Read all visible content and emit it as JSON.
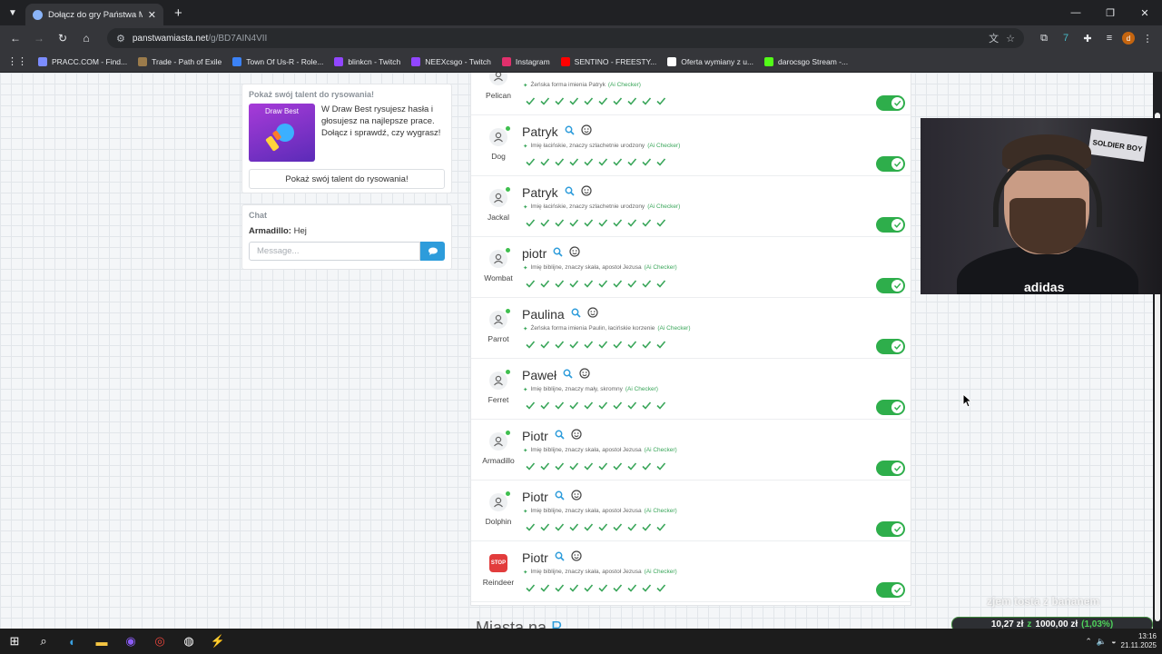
{
  "browser": {
    "tab_title": "Dołącz do gry Państwa Miasta",
    "url_host": "panstwamiasta.net",
    "url_path": "/g/BD7AIN4VII",
    "bookmarks": [
      {
        "label": "PRACC.COM - Find...",
        "color": "#7b8cff"
      },
      {
        "label": "Trade - Path of Exile",
        "color": "#9b7b4b"
      },
      {
        "label": "Town Of Us-R - Role...",
        "color": "#3b82f6"
      },
      {
        "label": "blinkcn - Twitch",
        "color": "#9146ff"
      },
      {
        "label": "NEEXcsgo - Twitch",
        "color": "#9146ff"
      },
      {
        "label": "Instagram",
        "color": "#e1306c"
      },
      {
        "label": "SENTINO - FREESTY...",
        "color": "#ff0000"
      },
      {
        "label": "Oferta wymiany z u...",
        "color": "#ffffff"
      },
      {
        "label": "darocsgo Stream -...",
        "color": "#53fc18"
      }
    ],
    "profile_initial": "d"
  },
  "promo": {
    "heading": "Pokaż swój talent do rysowania!",
    "thumb_title": "Draw Best",
    "description": "W Draw Best rysujesz hasła i głosujesz na najlepsze prace. Dołącz i sprawdź, czy wygrasz!",
    "button": "Pokaż swój talent do rysowania!"
  },
  "chat": {
    "heading": "Chat",
    "author": "Armadillo:",
    "message": "Hej",
    "placeholder": "Message..."
  },
  "answers": [
    {
      "player": "Pelican",
      "word": "",
      "hint": "Żeńska forma imienia Patryk",
      "ai": "(Ai Checker)",
      "stop": false
    },
    {
      "player": "Dog",
      "word": "Patryk",
      "hint": "Imię łacińskie, znaczy szlachetnie urodzony",
      "ai": "(Ai Checker)",
      "stop": false
    },
    {
      "player": "Jackal",
      "word": "Patryk",
      "hint": "Imię łacińskie, znaczy szlachetnie urodzony",
      "ai": "(Ai Checker)",
      "stop": false
    },
    {
      "player": "Wombat",
      "word": "piotr",
      "hint": "Imię biblijne, znaczy skała, apostoł Jezusa",
      "ai": "(Ai Checker)",
      "stop": false
    },
    {
      "player": "Parrot",
      "word": "Paulina",
      "hint": "Żeńska forma imienia Paulin, łacińskie korzenie",
      "ai": "(Ai Checker)",
      "stop": false
    },
    {
      "player": "Ferret",
      "word": "Paweł",
      "hint": "Imię biblijne, znaczy mały, skromny",
      "ai": "(Ai Checker)",
      "stop": false
    },
    {
      "player": "Armadillo",
      "word": "Piotr",
      "hint": "Imię biblijne, znaczy skała, apostoł Jezusa",
      "ai": "(Ai Checker)",
      "stop": false
    },
    {
      "player": "Dolphin",
      "word": "Piotr",
      "hint": "Imię biblijne, znaczy skała, apostoł Jezusa",
      "ai": "(Ai Checker)",
      "stop": false
    },
    {
      "player": "Reindeer",
      "word": "Piotr",
      "hint": "Imię biblijne, znaczy skała, apostoł Jezusa",
      "ai": "(Ai Checker)",
      "stop": true
    }
  ],
  "votes_per_row": 10,
  "next_section": {
    "text": "Miasta na",
    "letter": "P"
  },
  "stream": {
    "overlay_text": "zjem tosta z bananem",
    "donation_current": "10,27 zł",
    "donation_sep": "z",
    "donation_goal": "1000,00 zł",
    "donation_percent": "(1,03%)",
    "poster_text": "SOLDIER BOY",
    "shirt_text": "adidas"
  },
  "taskbar": {
    "time": "13:16",
    "date": "21.11.2025"
  }
}
